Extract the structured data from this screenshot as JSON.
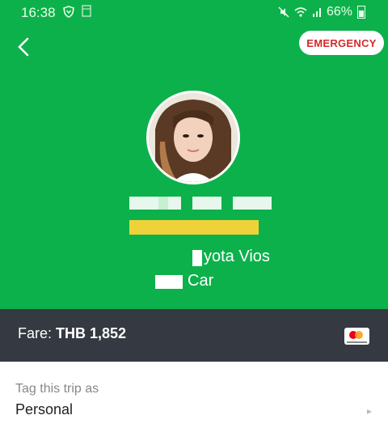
{
  "status_bar": {
    "time": "16:38",
    "battery": "66%"
  },
  "header": {
    "emergency_label": "EMERGENCY"
  },
  "driver": {
    "vehicle_model": "yota Vios",
    "service_type": "Car"
  },
  "fare": {
    "label": "Fare:",
    "value": "THB 1,852",
    "payment_icon": "mastercard-icon"
  },
  "trip_tag": {
    "label": "Tag this trip as",
    "value": "Personal"
  },
  "colors": {
    "brand_green": "#0db14b",
    "fare_bar": "#353941",
    "emergency_text": "#d12a2a"
  }
}
